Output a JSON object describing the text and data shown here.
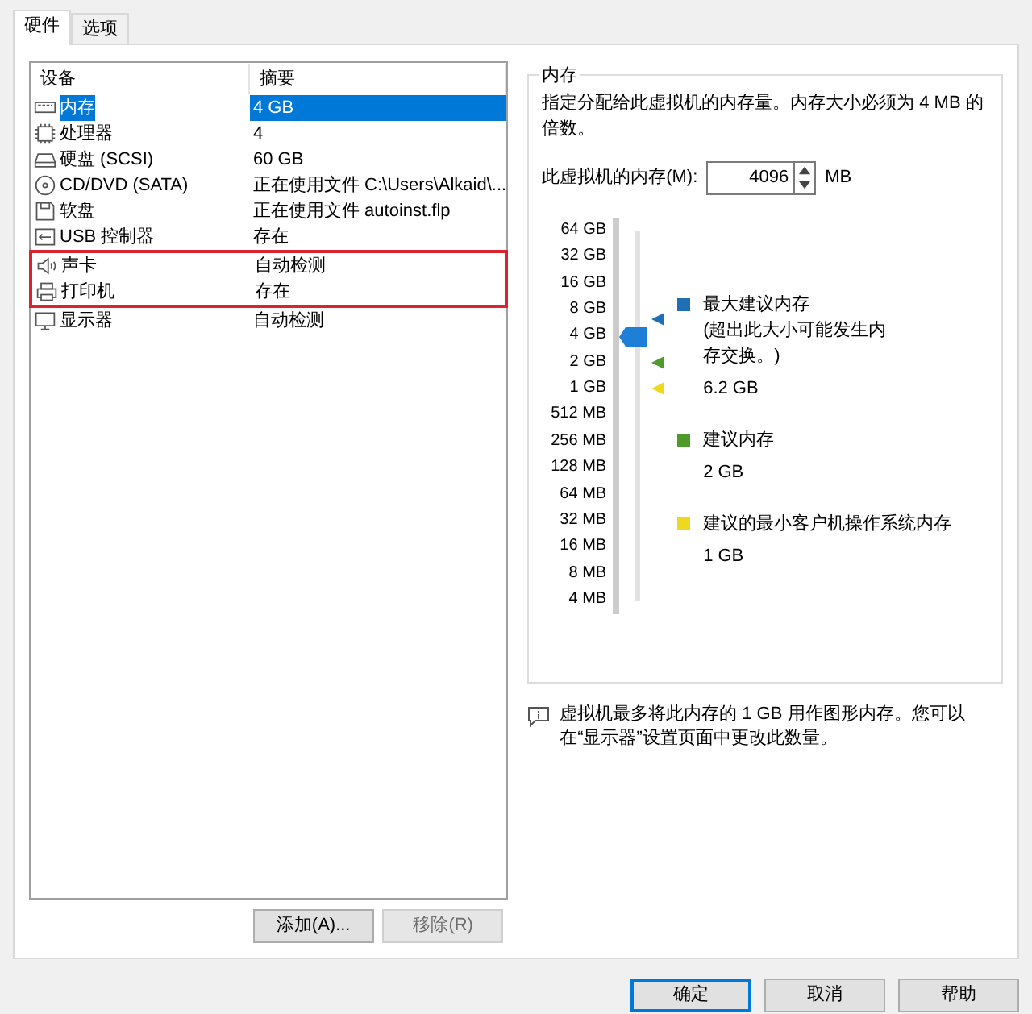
{
  "tabs": [
    {
      "label": "硬件",
      "selected": true
    },
    {
      "label": "选项",
      "selected": false
    }
  ],
  "devices": {
    "columns": [
      "设备",
      "摘要"
    ],
    "rows": [
      {
        "kind": "memory",
        "name": "内存",
        "summary": "4 GB",
        "selected": true,
        "highlighted": false
      },
      {
        "kind": "cpu",
        "name": "处理器",
        "summary": "4",
        "selected": false,
        "highlighted": false
      },
      {
        "kind": "disk",
        "name": "硬盘 (SCSI)",
        "summary": "60 GB",
        "selected": false,
        "highlighted": false
      },
      {
        "kind": "cdrom",
        "name": "CD/DVD (SATA)",
        "summary": "正在使用文件 C:\\Users\\Alkaid\\...",
        "selected": false,
        "highlighted": false
      },
      {
        "kind": "floppy",
        "name": "软盘",
        "summary": "正在使用文件 autoinst.flp",
        "selected": false,
        "highlighted": false
      },
      {
        "kind": "usb",
        "name": "USB 控制器",
        "summary": "存在",
        "selected": false,
        "highlighted": false
      },
      {
        "kind": "sound",
        "name": "声卡",
        "summary": "自动检测",
        "selected": false,
        "highlighted": true
      },
      {
        "kind": "printer",
        "name": "打印机",
        "summary": "存在",
        "selected": false,
        "highlighted": true
      },
      {
        "kind": "display",
        "name": "显示器",
        "summary": "自动检测",
        "selected": false,
        "highlighted": false
      }
    ]
  },
  "list_buttons": [
    {
      "label": "添加(A)...",
      "disabled": false
    },
    {
      "label": "移除(R)",
      "disabled": true
    }
  ],
  "memory": {
    "title": "内存",
    "description": "指定分配给此虚拟机的内存量。内存大小必须为 4 MB 的倍数。",
    "field_label": "此虚拟机的内存(M):",
    "value": "4096",
    "unit": "MB",
    "scale": [
      "64 GB",
      "32 GB",
      "16 GB",
      "8 GB",
      "4 GB",
      "2 GB",
      "1 GB",
      "512 MB",
      "256 MB",
      "128 MB",
      "64 MB",
      "32 MB",
      "16 MB",
      "8 MB",
      "4 MB"
    ],
    "slider": {
      "level": 0.714,
      "marks": [
        {
          "color": "#1f6fb5",
          "level": 0.759
        },
        {
          "color": "#4e9a2a",
          "level": 0.643
        },
        {
          "color": "#f0d820",
          "level": 0.571
        }
      ]
    },
    "markers": [
      {
        "color": "#1f6fb5",
        "title": "最大建议内存",
        "note": "(超出此大小可能发生内存交换。)",
        "value": "6.2 GB"
      },
      {
        "color": "#4e9a2a",
        "title": "建议内存",
        "value": "2 GB"
      },
      {
        "color": "#f0d820",
        "title": "建议的最小客户机操作系统内存",
        "value": "1 GB"
      }
    ],
    "info": "虚拟机最多将此内存的 1 GB 用作图形内存。您可以在“显示器”设置页面中更改此数量。"
  },
  "dialog_buttons": [
    {
      "label": "确定",
      "default": true
    },
    {
      "label": "取消",
      "default": false
    },
    {
      "label": "帮助",
      "default": false
    }
  ]
}
